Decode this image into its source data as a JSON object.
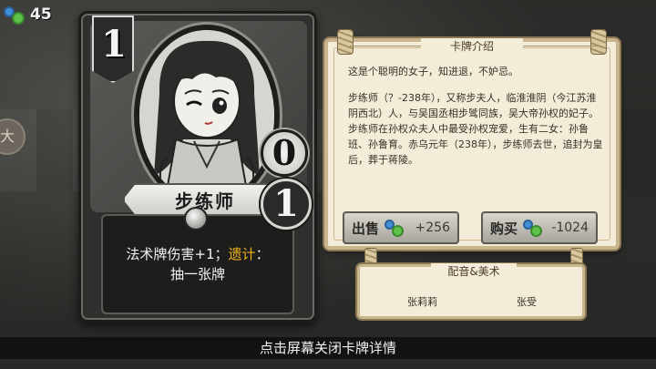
{
  "currency": {
    "amount": "45",
    "icon": "gem-pair-icon"
  },
  "background": {
    "side_button_glyph": "大"
  },
  "card": {
    "cost": "1",
    "name": "步练师",
    "attack": "0",
    "health": "1",
    "description_line1_prefix": "法术牌伤害+1；",
    "description_keyword": "遗计",
    "description_line1_suffix": "：",
    "description_line2": "抽一张牌",
    "keyword_color": "#f1b21a"
  },
  "info_panel": {
    "title": "卡牌介绍",
    "intro_short": "这是个聪明的女子，知进退，不妒忌。",
    "intro_long": "步练师（？-238年），又称步夫人，临淮淮阴（今江苏淮阴西北）人，与吴国丞相步骘同族，吴大帝孙权的妃子。步练师在孙权众夫人中最受孙权宠爱，生有二女：孙鲁班、孙鲁育。赤乌元年（238年），步练师去世，追封为皇后，葬于蒋陵。",
    "sell_button": {
      "label": "出售",
      "amount": "+256"
    },
    "buy_button": {
      "label": "购买",
      "amount": "-1024"
    }
  },
  "credits": {
    "title": "配音&美术",
    "voice": "张莉莉",
    "art": "张受"
  },
  "hint": "点击屏幕关闭卡牌详情"
}
